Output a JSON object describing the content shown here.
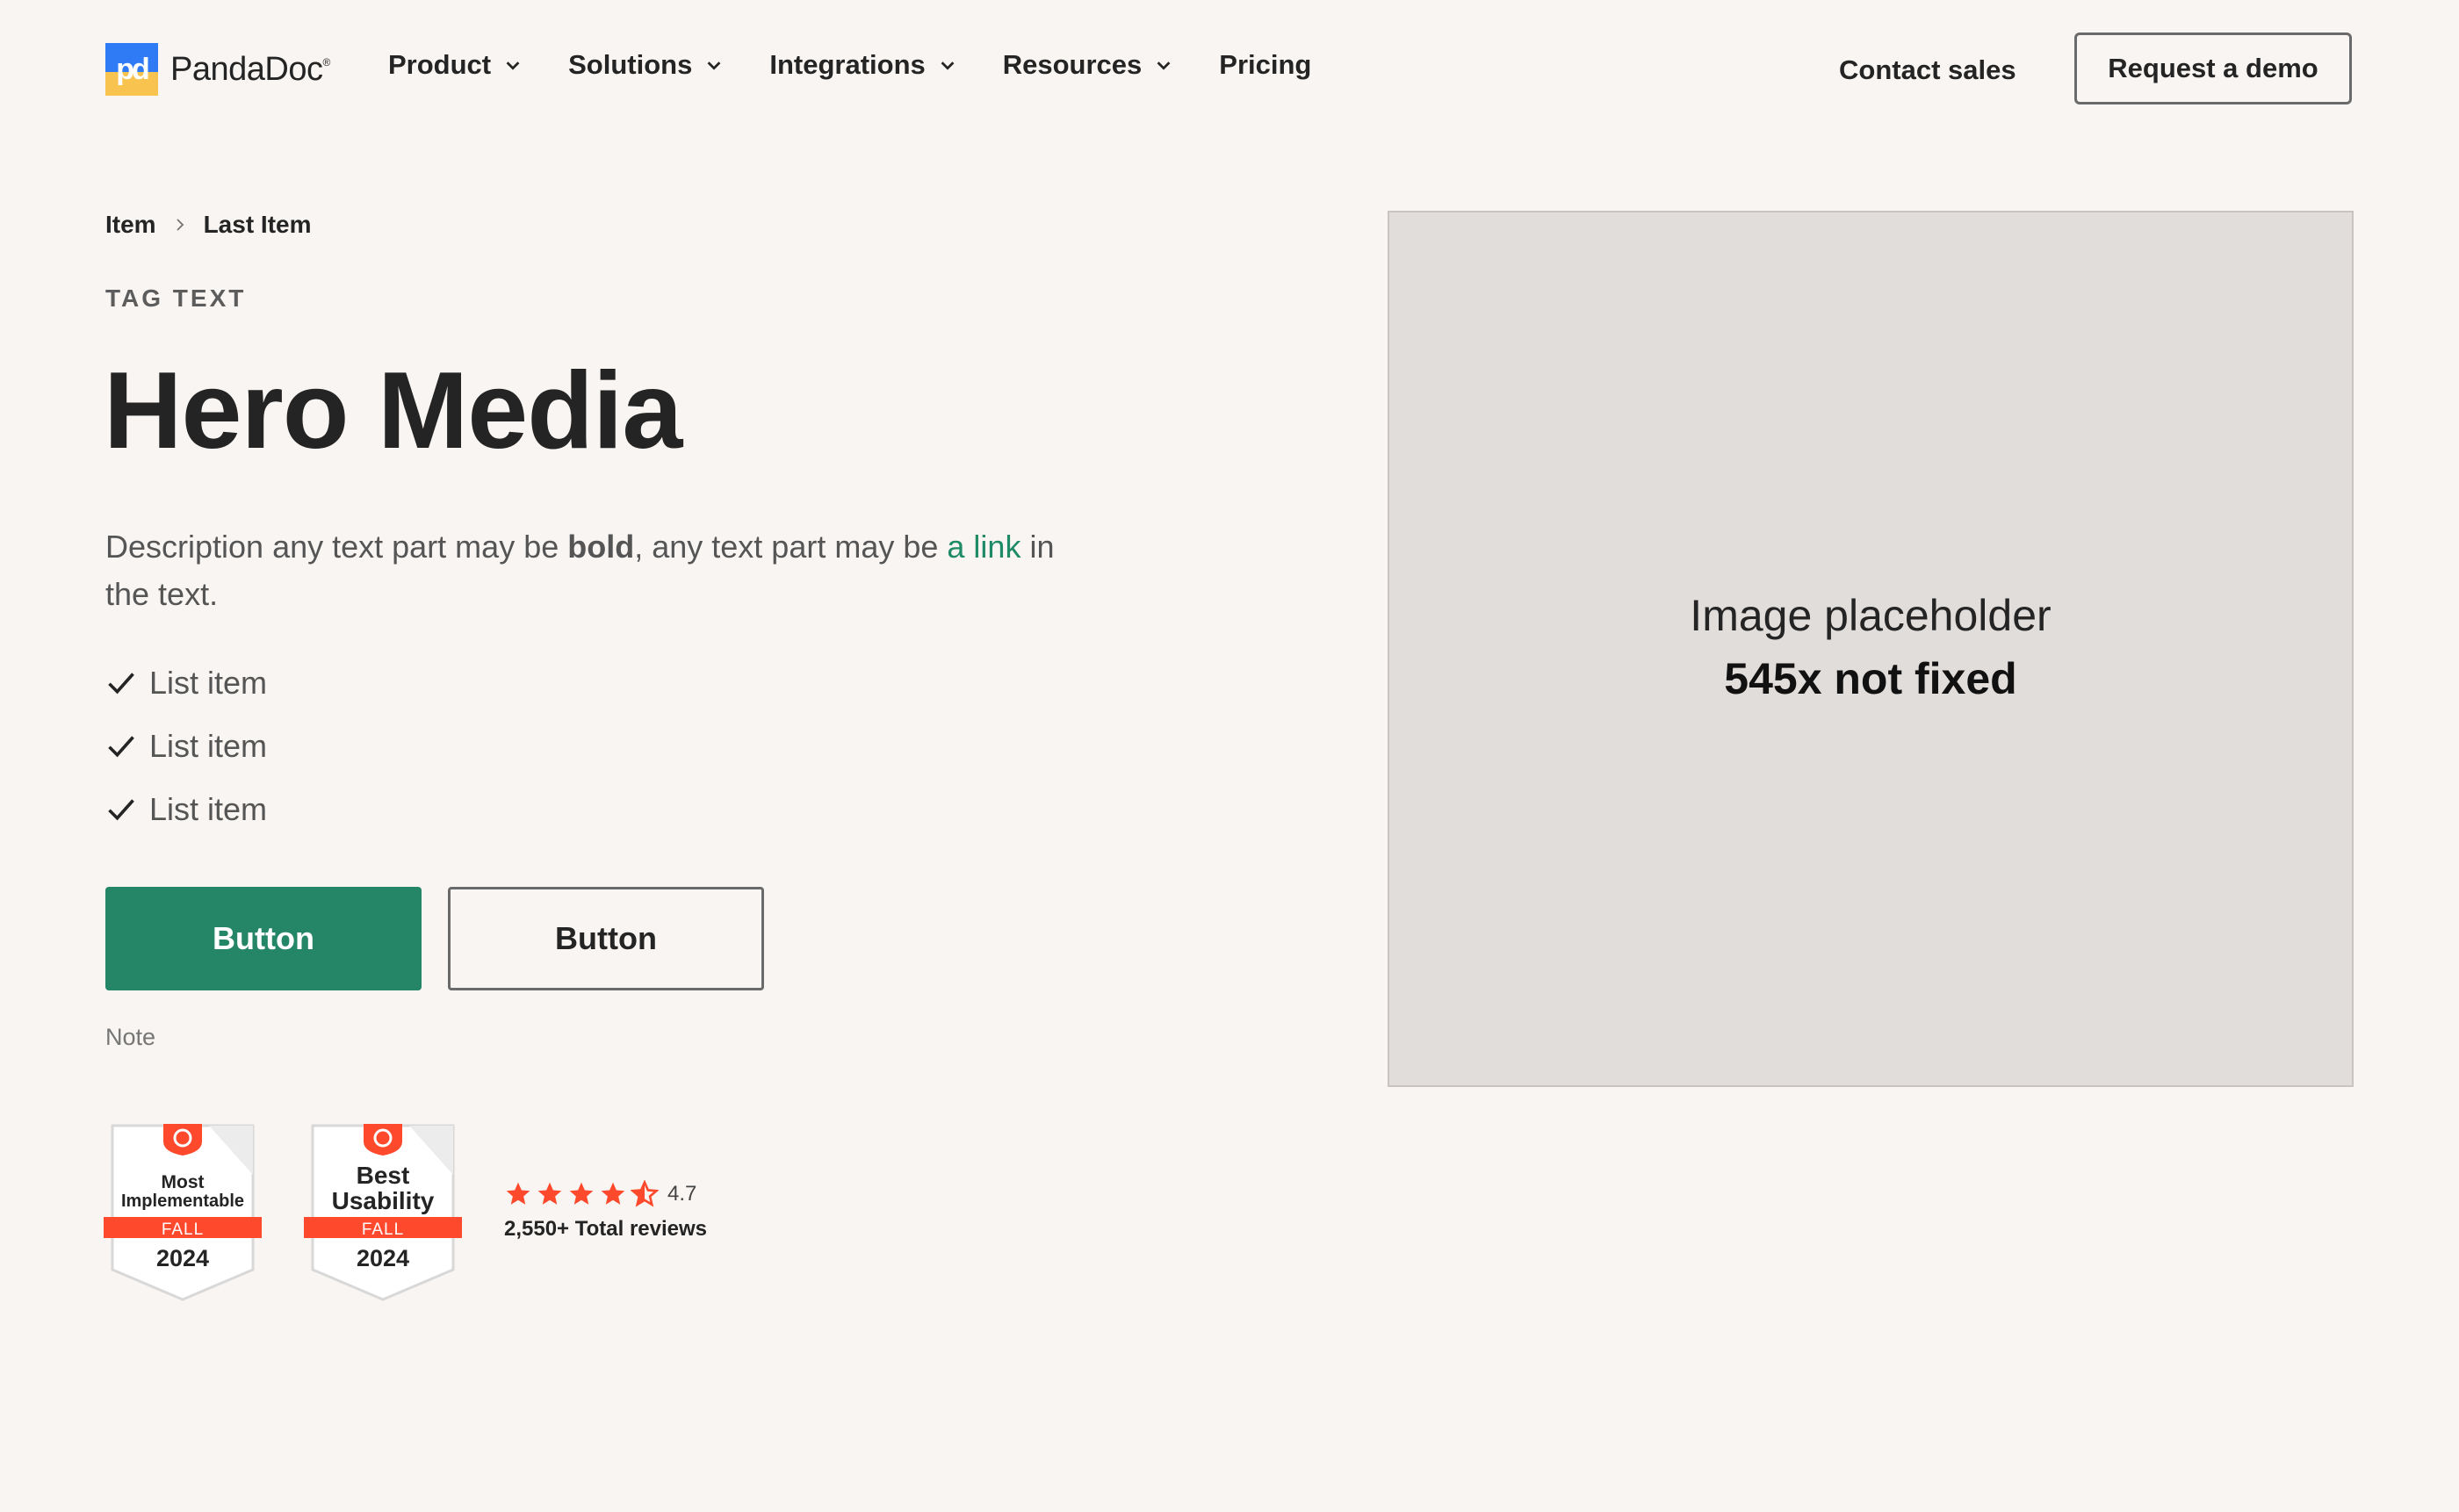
{
  "header": {
    "logo_mark": "pd",
    "logo_text": "PandaDoc",
    "logo_reg": "®",
    "nav": [
      {
        "label": "Product",
        "has_dropdown": true
      },
      {
        "label": "Solutions",
        "has_dropdown": true
      },
      {
        "label": "Integrations",
        "has_dropdown": true
      },
      {
        "label": "Resources",
        "has_dropdown": true
      },
      {
        "label": "Pricing",
        "has_dropdown": false
      }
    ],
    "contact_label": "Contact sales",
    "demo_label": "Request a demo"
  },
  "breadcrumb": {
    "items": [
      "Item",
      "Last Item"
    ],
    "separator_icon": "chevron-right-icon"
  },
  "hero": {
    "tag": "TAG TEXT",
    "title": "Hero Media",
    "description": {
      "part1": "Description any text part may be ",
      "bold": "bold",
      "part2": ", any text part may be ",
      "link": "a link",
      "part3": " in the text."
    },
    "list": [
      "List item",
      "List item",
      "List item"
    ],
    "primary_button": "Button",
    "secondary_button": "Button",
    "note": "Note"
  },
  "badges": [
    {
      "title_line1": "Most",
      "title_line2": "Implementable",
      "season": "FALL",
      "year": "2024",
      "logo": "G2"
    },
    {
      "title_line1": "Best",
      "title_line2": "Usability",
      "season": "FALL",
      "year": "2024",
      "logo": "G2"
    }
  ],
  "rating": {
    "value": "4.7",
    "stars": 4.5,
    "reviews": "2,550+ Total reviews"
  },
  "placeholder": {
    "line1": "Image placeholder",
    "line2": "545x not fixed"
  },
  "colors": {
    "background": "#f8f5f2",
    "primary": "#248567",
    "link": "#1e8a66",
    "badge_red": "#ff492c",
    "logo_blue": "#2f7bf6",
    "logo_yellow": "#f8c34f",
    "placeholder_bg": "#e1dddb"
  }
}
